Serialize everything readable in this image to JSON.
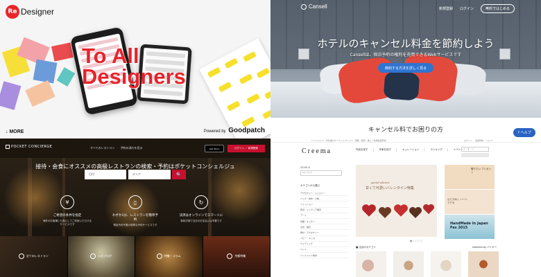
{
  "redesigner": {
    "logo_badge": "Re",
    "logo_text": "Designer",
    "hero_line1": "To All",
    "hero_line2": "Designers",
    "more": "↓ MORE",
    "powered": "Powered by",
    "powered_brand": "Goodpatch",
    "accent": "#e7232a"
  },
  "cansell": {
    "brand": "Cansell",
    "nav": [
      "新規登録",
      "ログイン"
    ],
    "nav_button": "無料ではじめる",
    "headline": "ホテルのキャンセル料金を節約しよう",
    "subline": "Cansellは、宿泊予約の権利を売買できるWebサービスです",
    "cta": "節約する方法を詳しく見る",
    "question": "キャンセル料でお困りの方",
    "help": "ヘルプ",
    "accent": "#2f74d0"
  },
  "pocket": {
    "brand": "POCKET CONCIERGE",
    "links": [
      "すべてのレストラン",
      "予約の流れを見る"
    ],
    "appstore": "App Store",
    "login": "ログイン ／ 新規登録",
    "headline": "接待・会食にオススメの高級レストランの検索・予約はポケットコンシェルジュ",
    "select_date": "日付",
    "select_area": "エリア",
    "search_icon": "🔍",
    "features": [
      {
        "icon": "¥",
        "title": "ご希望の条件を指定",
        "desc": "海外のお客様にも安心してご利用いただけるサービスです"
      },
      {
        "icon": "▯",
        "title": "わずか1分、レストランを簡単予約",
        "desc": "電話予約不要の簡単な予約サービスです"
      },
      {
        "icon": "↻",
        "title": "決済はオンラインでスマートに",
        "desc": "事前決済で当日のお支払いは不要です"
      }
    ],
    "cards": [
      "全てのレストラン",
      "公式ブログ",
      "特集・コラム",
      "京都特集"
    ],
    "accent": "#c8102e"
  },
  "creema": {
    "logo": "Creema",
    "topline_left": "ハンドメイド、手仕事のマーケットプレイス・通販・販売・購入 | 新規会員登録",
    "topline_right": [
      "ログイン",
      "会員登録",
      "ヘルプ"
    ],
    "menu": [
      "作品を探す",
      "作家を探す",
      "キュレーション",
      "ランキング",
      "イベント"
    ],
    "search_placeholder": "キーワード",
    "side_search_label": "SEARCH",
    "side_search_placeholder": "Key Word",
    "category_heading": "カテゴリから選ぶ",
    "categories": [
      "アクセサリー・ジュエリー",
      "バッグ・財布・小物",
      "ファッション",
      "家具・インテリア雑貨",
      "アート",
      "食器・キッチン",
      "文具・雑貨",
      "時計・アクセサリー",
      "ベビー・キッズ",
      "ウェディング",
      "ペット",
      "ハンドメイド素材"
    ],
    "banner_special": "special selection",
    "banner_title": "甘くて可愛いバレンタイン特集",
    "tile1": "贈りたい プレゼント",
    "tile2": "心ときめく ハートアクセ",
    "tile3": "HandMade In Japan Fes 2015",
    "slider_dots": "● ○ ○ ○",
    "picks": "■ 注目のカテゴリ",
    "selected_by": "selected by バイヤー"
  }
}
